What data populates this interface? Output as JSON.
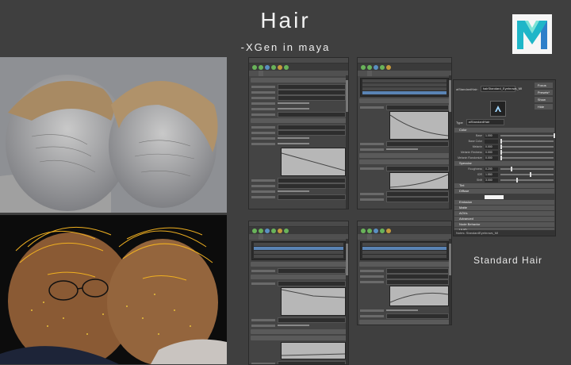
{
  "header": {
    "title": "Hair",
    "subtitle": "-XGen in maya"
  },
  "logo": {
    "letter": "M",
    "colors": [
      "#1fb6c8",
      "#2d7fc9",
      "#7be3d6"
    ]
  },
  "caption": "Standard Hair",
  "colors": {
    "background": "#3f3f3f",
    "panel": "#444444",
    "selection": "#5a84b5",
    "icon_green": "#69b35a"
  },
  "icons": [
    "maya-logo-icon",
    "xgen-toolbar-icon",
    "arnold-shader-icon"
  ],
  "attribute_editor": {
    "shader_name": "aiStandardHair:",
    "name_field": "hairStandard_Eyebrows_MI",
    "buttons": [
      "Focus",
      "Presets*",
      "Show",
      "Hide"
    ],
    "type_label": "Type",
    "type_value": "aiStandardHair",
    "footer": "Notes: StandardEyebrows_MI",
    "groups": [
      "Color",
      "Specular",
      "Tint",
      "Diffuse",
      "Emission",
      "Matte",
      "AOVs",
      "Advanced",
      "Node Behavior",
      "UUID"
    ],
    "color_rows": [
      {
        "label": "Base",
        "value": "1.000",
        "level": 1.0
      },
      {
        "label": "Base Color",
        "value": "",
        "level": 0.0
      },
      {
        "label": "Melanin",
        "value": "0.000",
        "level": 0.0
      },
      {
        "label": "Melanin Redness",
        "value": "0.000",
        "level": 0.0
      },
      {
        "label": "Melanin Randomize",
        "value": "0.000",
        "level": 0.0
      }
    ],
    "specular_rows": [
      {
        "label": "Roughness",
        "value": "0.200",
        "level": 0.2
      },
      {
        "label": "IOR",
        "value": "1.550",
        "level": 0.55
      },
      {
        "label": "Shift",
        "value": "3.000",
        "level": 0.3
      }
    ]
  }
}
